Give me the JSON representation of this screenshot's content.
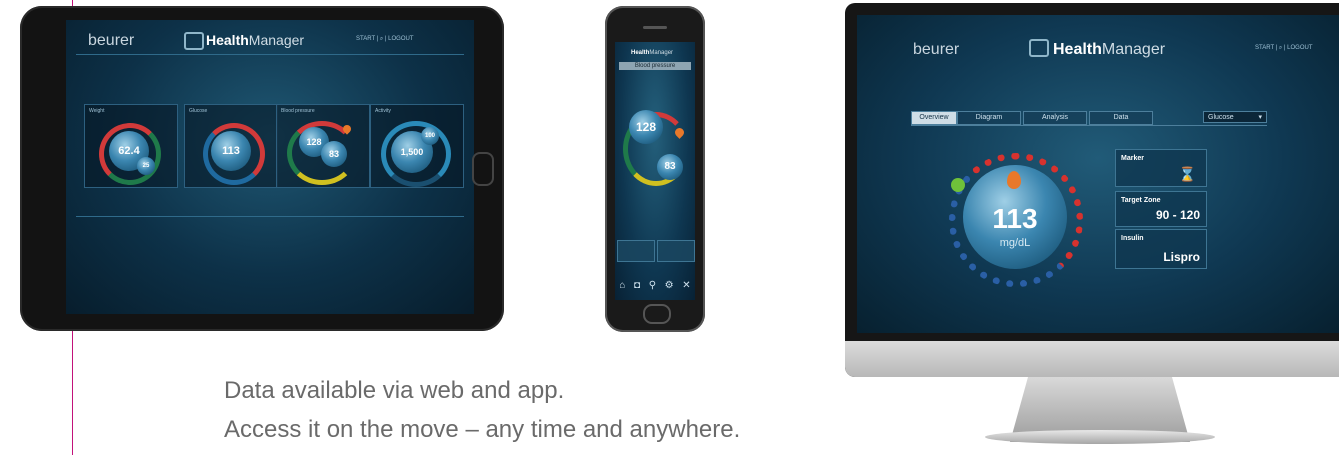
{
  "caption": {
    "line1": "Data available via web and app.",
    "line2": "Access it on the move – any time and anywhere."
  },
  "app": {
    "brand": "beurer",
    "title_bold": "Health",
    "title_rest": "Manager",
    "header_links": "START | ⌕ | LOGOUT"
  },
  "tablet": {
    "tiles": [
      {
        "label": "Weight",
        "value": "62.4",
        "sub": "25"
      },
      {
        "label": "Glucose",
        "value": "113"
      },
      {
        "label": "Blood pressure",
        "value1": "128",
        "value2": "83"
      },
      {
        "label": "Activity",
        "value": "1,500",
        "sub": "100"
      }
    ]
  },
  "phone": {
    "banner": "Blood pressure",
    "sys": "128",
    "dia": "83",
    "tab_icons": [
      "home-icon",
      "camera-icon",
      "search-icon",
      "gear-icon",
      "tools-icon"
    ]
  },
  "monitor": {
    "tabs": [
      "Overview",
      "Diagram",
      "Analysis",
      "Data"
    ],
    "dropdown": "Glucose",
    "glucose_value": "113",
    "glucose_unit": "mg/dL",
    "marker_label": "Marker",
    "target_label": "Target Zone",
    "target_value": "90 - 120",
    "insulin_label": "Insulin",
    "insulin_value": "Lispro"
  }
}
